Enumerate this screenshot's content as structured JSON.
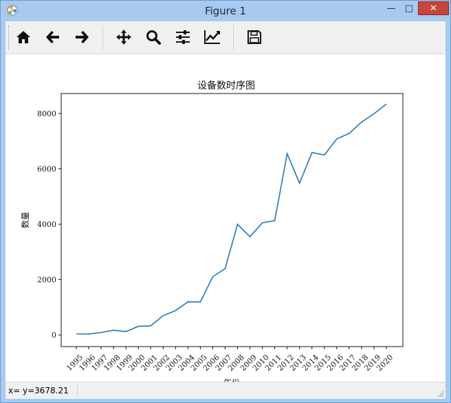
{
  "window": {
    "title": "Figure 1",
    "minimize": "—",
    "maximize": "□",
    "close": "✕"
  },
  "toolbar": {
    "tools": [
      "home-icon",
      "back-arrow-icon",
      "forward-arrow-icon",
      "pan-icon",
      "zoom-icon",
      "subplots-config-icon",
      "edit-axis-icon",
      "save-icon"
    ]
  },
  "status": {
    "text": "x= y=3678.21"
  },
  "colors": {
    "line": "#1f77b4",
    "titlebar": "#a9c9ee",
    "close": "#c7463b"
  },
  "chart_data": {
    "type": "line",
    "title": "设备数时序图",
    "xlabel": "年份",
    "ylabel": "数量",
    "categories": [
      "1995",
      "1996",
      "1997",
      "1998",
      "1999",
      "2000",
      "2001",
      "2002",
      "2003",
      "2004",
      "2005",
      "2006",
      "2007",
      "2008",
      "2009",
      "2010",
      "2011",
      "2012",
      "2013",
      "2014",
      "2015",
      "2016",
      "2017",
      "2018",
      "2019",
      "2020"
    ],
    "values": [
      40,
      35,
      90,
      170,
      125,
      310,
      330,
      700,
      880,
      1200,
      1190,
      2100,
      2400,
      4000,
      3550,
      4050,
      4130,
      6550,
      5480,
      6590,
      6500,
      7080,
      7280,
      7690,
      7990,
      8340
    ],
    "yticks": [
      "0",
      "2000",
      "4000",
      "6000",
      "8000"
    ],
    "ytick_values": [
      0,
      2000,
      4000,
      6000,
      8000
    ],
    "ylim": [
      -420,
      8720
    ],
    "grid": false,
    "legend": false
  }
}
